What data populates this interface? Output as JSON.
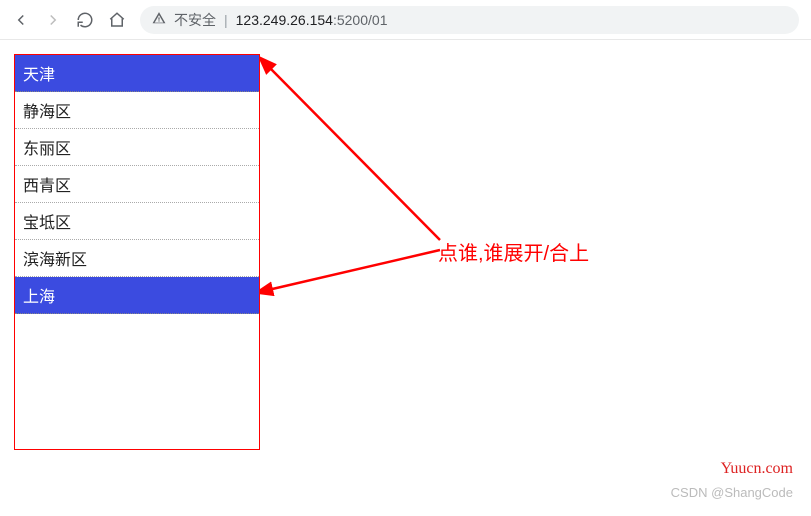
{
  "toolbar": {
    "security_label": "不安全",
    "url_host": "123.249.26.154",
    "url_port": ":5200",
    "url_path": "/01"
  },
  "list": {
    "header1": "天津",
    "items1": [
      "静海区",
      "东丽区",
      "西青区",
      "宝坻区",
      "滨海新区"
    ],
    "header2": "上海"
  },
  "annotation": "点谁,谁展开/合上",
  "watermark1": "Yuucn.com",
  "watermark2": "CSDN @ShangCode"
}
